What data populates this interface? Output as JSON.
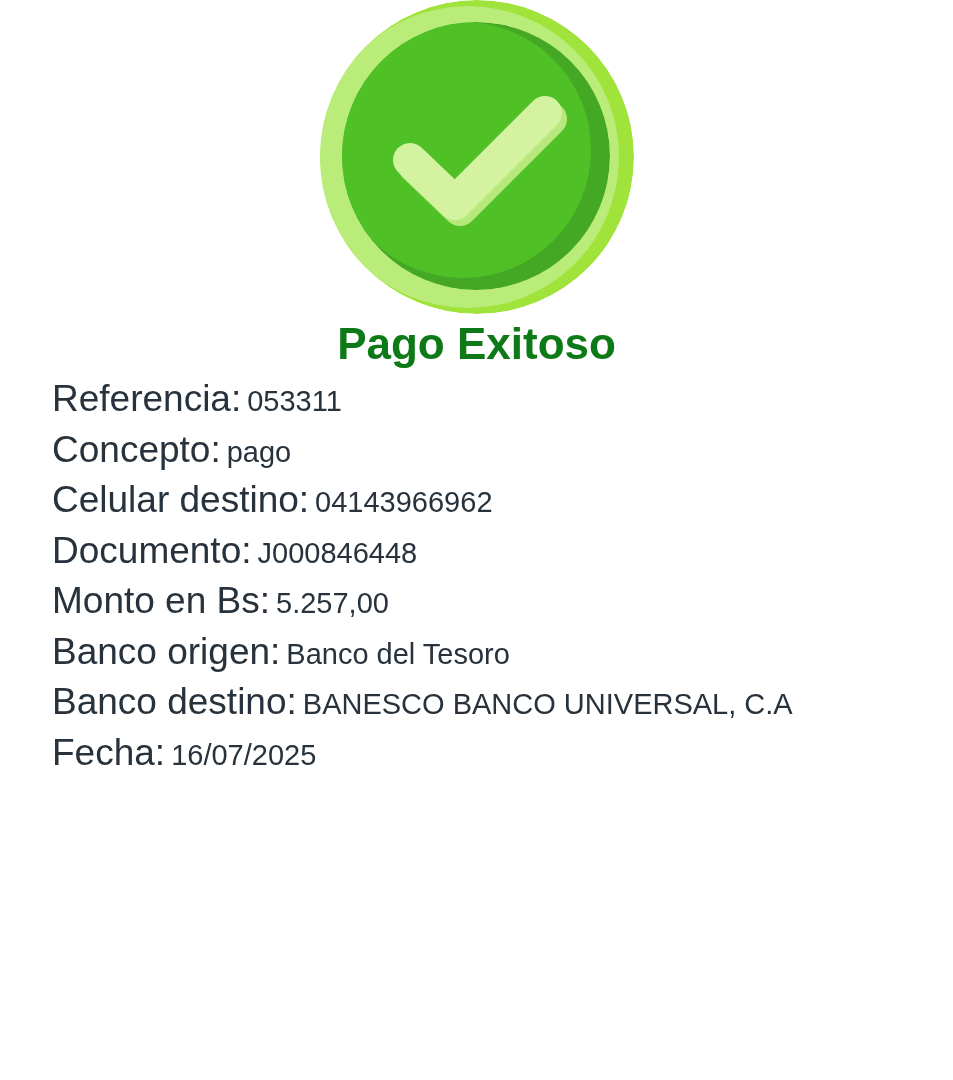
{
  "status": {
    "kind": "success",
    "title": "Pago Exitoso"
  },
  "details": [
    {
      "label": "Referencia:",
      "value": "053311"
    },
    {
      "label": "Concepto:",
      "value": "pago"
    },
    {
      "label": "Celular destino:",
      "value": "04143966962"
    },
    {
      "label": "Documento:",
      "value": "J000846448"
    },
    {
      "label": "Monto en Bs:",
      "value": "5.257,00"
    },
    {
      "label": "Banco origen:",
      "value": "Banco del Tesoro"
    },
    {
      "label": "Banco destino:",
      "value": "BANESCO BANCO UNIVERSAL, C.A"
    },
    {
      "label": "Fecha:",
      "value": "16/07/2025"
    }
  ]
}
